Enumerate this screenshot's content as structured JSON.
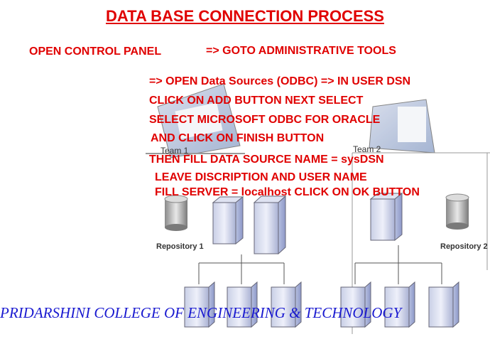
{
  "title": "DATA BASE CONNECTION PROCESS",
  "steps": {
    "s1": "OPEN CONTROL PANEL",
    "s2": "=> GOTO ADMINISTRATIVE TOOLS",
    "s3": "=> OPEN Data Sources (ODBC) => IN USER DSN",
    "s4": "CLICK ON ADD BUTTON NEXT SELECT",
    "s5": "SELECT MICROSOFT ODBC FOR ORACLE",
    "s6": "AND CLICK ON FINISH BUTTON",
    "s7": "THEN FILL DATA SOURCE NAME = sysDSN",
    "s8": "LEAVE DISCRIPTION AND USER NAME",
    "s9": "FILL SERVER = localhost CLICK ON OK BUTTON"
  },
  "diagram": {
    "team1": "Team 1",
    "team2": "Team 2",
    "repo1": "Repository 1",
    "repo2": "Repository 2"
  },
  "footer": "PRIDARSHINI  COLLEGE OF ENGINEERING & TECHNOLOGY"
}
